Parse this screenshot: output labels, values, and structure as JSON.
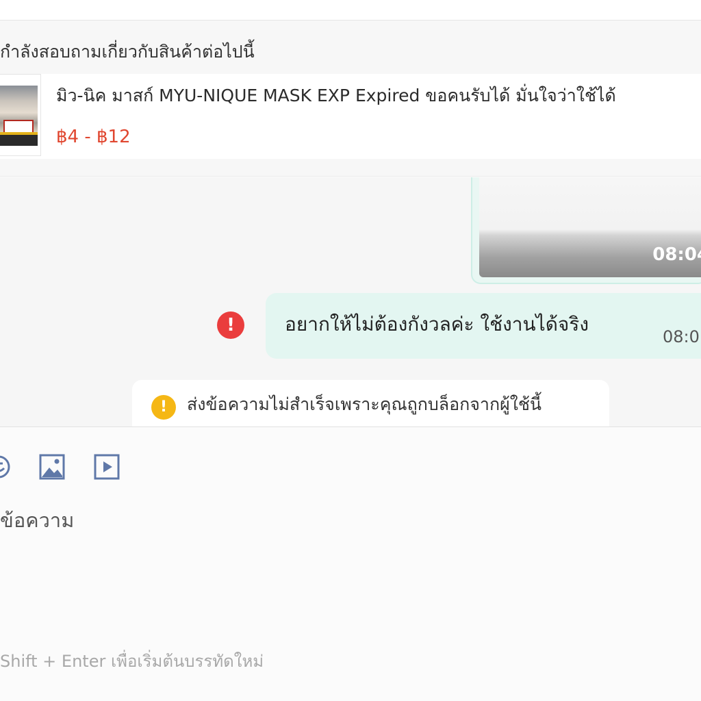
{
  "header": {
    "asking_label": "กำลังสอบถามเกี่ยวกับสินค้าต่อไปนี้"
  },
  "product": {
    "title": "มิว-นิค มาสก์ MYU-NIQUE MASK EXP Expired ขอคนรับได้ มั่นใจว่าใช้ได้",
    "price": "฿4 - ฿12",
    "price_color": "#e0462f",
    "thumbnail_icon": "product-thumbnail"
  },
  "chat": {
    "image_message": {
      "time": "08:04"
    },
    "text_message": {
      "text": "อยากให้ไม่ต้องกังวลค่ะ ใช้งานได้จริง",
      "time": "08:0",
      "status_icon": "error-icon",
      "status_color": "#ea3d3d",
      "bubble_color": "#e3f6f1"
    },
    "notice": {
      "text": "ส่งข้อความไม่สำเร็จเพราะคุณถูกบล็อกจากผู้ใช้นี้",
      "icon": "warning-icon",
      "icon_color": "#f5b715"
    }
  },
  "composer": {
    "toolbar_icons": [
      "emoji-icon",
      "image-icon",
      "video-icon"
    ],
    "placeholder": "ข้อความ",
    "hint": "Shift + Enter เพื่อเริ่มต้นบรรทัดใหม่"
  }
}
